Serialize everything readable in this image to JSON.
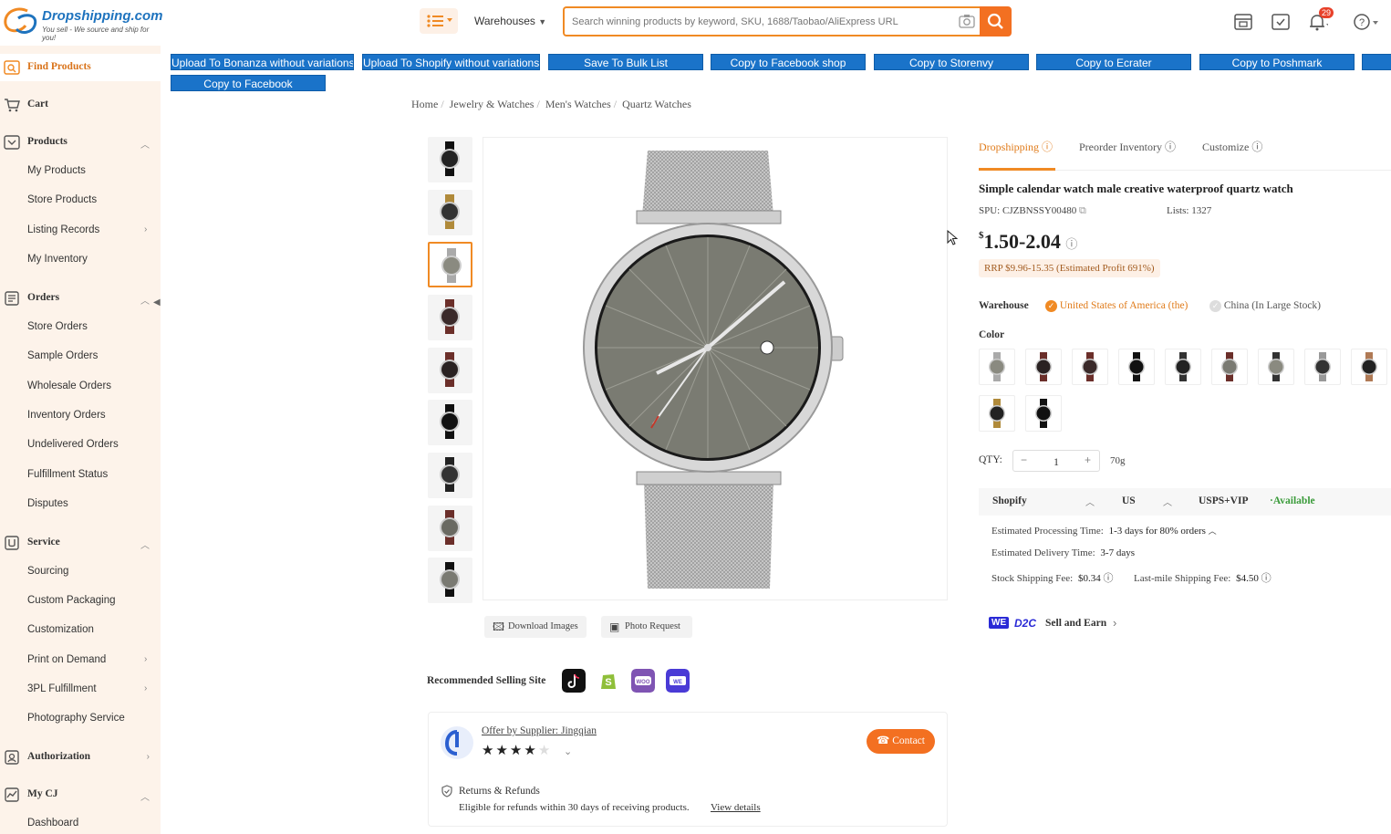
{
  "header": {
    "logo_brand": "Dropshipping.com",
    "logo_tagline": "You sell - We source and ship for you!",
    "warehouses_label": "Warehouses",
    "search_placeholder": "Search winning products by keyword, SKU, 1688/Taobao/AliExpress URL",
    "notification_count": "29",
    "icons": [
      "menu-icon",
      "camera-icon",
      "search-icon",
      "calendar-icon",
      "task-icon",
      "bell-icon",
      "help-icon"
    ]
  },
  "sidebar": {
    "find_products": "Find Products",
    "cart": "Cart",
    "products": "Products",
    "products_items": [
      "My Products",
      "Store Products",
      "Listing Records",
      "My Inventory"
    ],
    "orders": "Orders",
    "orders_items": [
      "Store Orders",
      "Sample Orders",
      "Wholesale Orders",
      "Inventory Orders",
      "Undelivered Orders",
      "Fulfillment Status",
      "Disputes"
    ],
    "service": "Service",
    "service_items": [
      "Sourcing",
      "Custom Packaging",
      "Customization",
      "Print on Demand",
      "3PL Fulfillment",
      "Photography Service"
    ],
    "authorization": "Authorization",
    "my_cj": "My CJ",
    "my_cj_items": [
      "Dashboard"
    ]
  },
  "actions": [
    "Upload To Bonanza without variations",
    "Upload To Shopify without variations",
    "Save To Bulk List",
    "Copy to Facebook shop",
    "Copy to Storenvy",
    "Copy to Ecrater",
    "Copy to Poshmark",
    "Copy to Facebook"
  ],
  "breadcrumb": [
    "Home",
    "Jewelry & Watches",
    "Men's Watches",
    "Quartz Watches"
  ],
  "gallery": {
    "download_label": "Download Images",
    "photo_request_label": "Photo Request",
    "recommended_label": "Recommended Selling Site",
    "selected_index": 2
  },
  "supplier": {
    "offer_text": "Offer by Supplier: Jingqian",
    "stars": 4,
    "contact_label": "Contact",
    "returns_title": "Returns & Refunds",
    "returns_text": "Eligible for refunds within 30 days of receiving products.",
    "view_details": "View details"
  },
  "product": {
    "tabs": [
      "Dropshipping",
      "Preorder Inventory",
      "Customize"
    ],
    "active_tab": "Dropshipping",
    "title": "Simple calendar watch male creative waterproof quartz watch",
    "spu_label": "SPU:",
    "spu": "CJZBNSSY00480",
    "lists": "Lists: 1327",
    "price_symbol": "$",
    "price": "1.50-2.04",
    "rrp": "RRP $9.96-15.35 (Estimated Profit 691%)",
    "warehouse_label": "Warehouse",
    "warehouse_options": [
      "United States of America (the)",
      "China (In Large Stock)"
    ],
    "color_label": "Color",
    "qty_label": "QTY:",
    "qty": "1",
    "weight": "70g",
    "ship_platform": "Shopify",
    "ship_country": "US",
    "ship_method": "USPS+VIP",
    "ship_status": "·Available",
    "processing": "Estimated Processing Time:",
    "processing_val": "1-3 days for 80% orders",
    "delivery": "Estimated Delivery Time:",
    "delivery_val": "3-7 days",
    "stock_fee": "Stock Shipping Fee:",
    "stock_fee_val": "$0.34",
    "lastmile_fee": "Last-mile Shipping Fee:",
    "lastmile_fee_val": "$4.50",
    "d2c_badge": "WE",
    "d2c_label": "D2C",
    "d2c_text": "Sell and Earn"
  },
  "colors": {
    "accent": "#f08a24",
    "action_blue": "#1a73c9",
    "sidebar_bg": "#fdf3ea",
    "available_green": "#3a9b3a"
  }
}
